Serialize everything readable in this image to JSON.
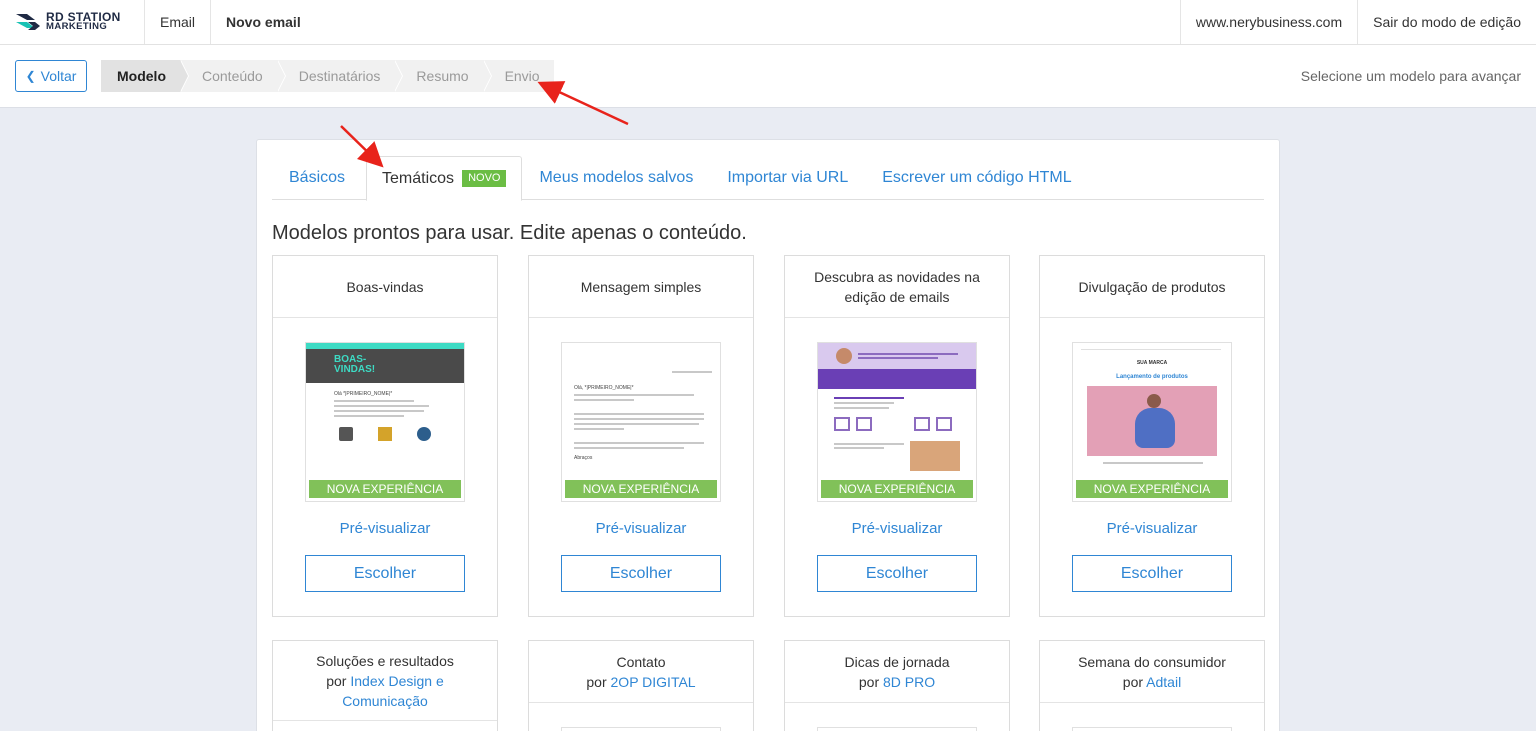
{
  "topbar": {
    "logo_line1": "RD STATION",
    "logo_line2": "MARKETING",
    "nav_email": "Email",
    "nav_current": "Novo email",
    "domain": "www.nerybusiness.com",
    "exit_edit": "Sair do modo de edição"
  },
  "subbar": {
    "back_label": "Voltar",
    "steps": [
      "Modelo",
      "Conteúdo",
      "Destinatários",
      "Resumo",
      "Envio"
    ],
    "hint": "Selecione um modelo para avançar"
  },
  "tabs": {
    "basic": "Básicos",
    "thematic": "Temáticos",
    "badge": "NOVO",
    "saved": "Meus modelos salvos",
    "import_url": "Importar via URL",
    "write_html": "Escrever um código HTML"
  },
  "subtitle": "Modelos prontos para usar. Edite apenas o conteúdo.",
  "cards": [
    {
      "title": "Boas-vindas",
      "badge": "NOVA EXPERIÊNCIA",
      "preview": "Pré-visualizar",
      "choose": "Escolher"
    },
    {
      "title": "Mensagem simples",
      "badge": "NOVA EXPERIÊNCIA",
      "preview": "Pré-visualizar",
      "choose": "Escolher"
    },
    {
      "title": "Descubra as novidades na edição de emails",
      "badge": "NOVA EXPERIÊNCIA",
      "preview": "Pré-visualizar",
      "choose": "Escolher"
    },
    {
      "title": "Divulgação de produtos",
      "badge": "NOVA EXPERIÊNCIA",
      "preview": "Pré-visualizar",
      "choose": "Escolher"
    }
  ],
  "cards_row2": [
    {
      "title": "Soluções e resultados",
      "by": "por",
      "author": "Index Design e Comunicação"
    },
    {
      "title": "Contato",
      "by": "por",
      "author": "2OP DIGITAL"
    },
    {
      "title": "Dicas de jornada",
      "by": "por",
      "author": "8D PRO"
    },
    {
      "title": "Semana do consumidor",
      "by": "por",
      "author": "Adtail"
    }
  ],
  "thumbs": {
    "welcome_heading": "BOAS-VINDAS!",
    "welcome_greeting": "Olá *|PRIMEIRO_NOME|*",
    "simple_greeting": "Olá, *|PRIMEIRO_NOME|*",
    "simple_footer": "Abraços",
    "product_brand": "SUA MARCA",
    "product_heading": "Lançamento de produtos"
  },
  "colors": {
    "accent": "#2f86d4",
    "badge_green": "#6bbd44",
    "annotation_red": "#e8231b"
  }
}
